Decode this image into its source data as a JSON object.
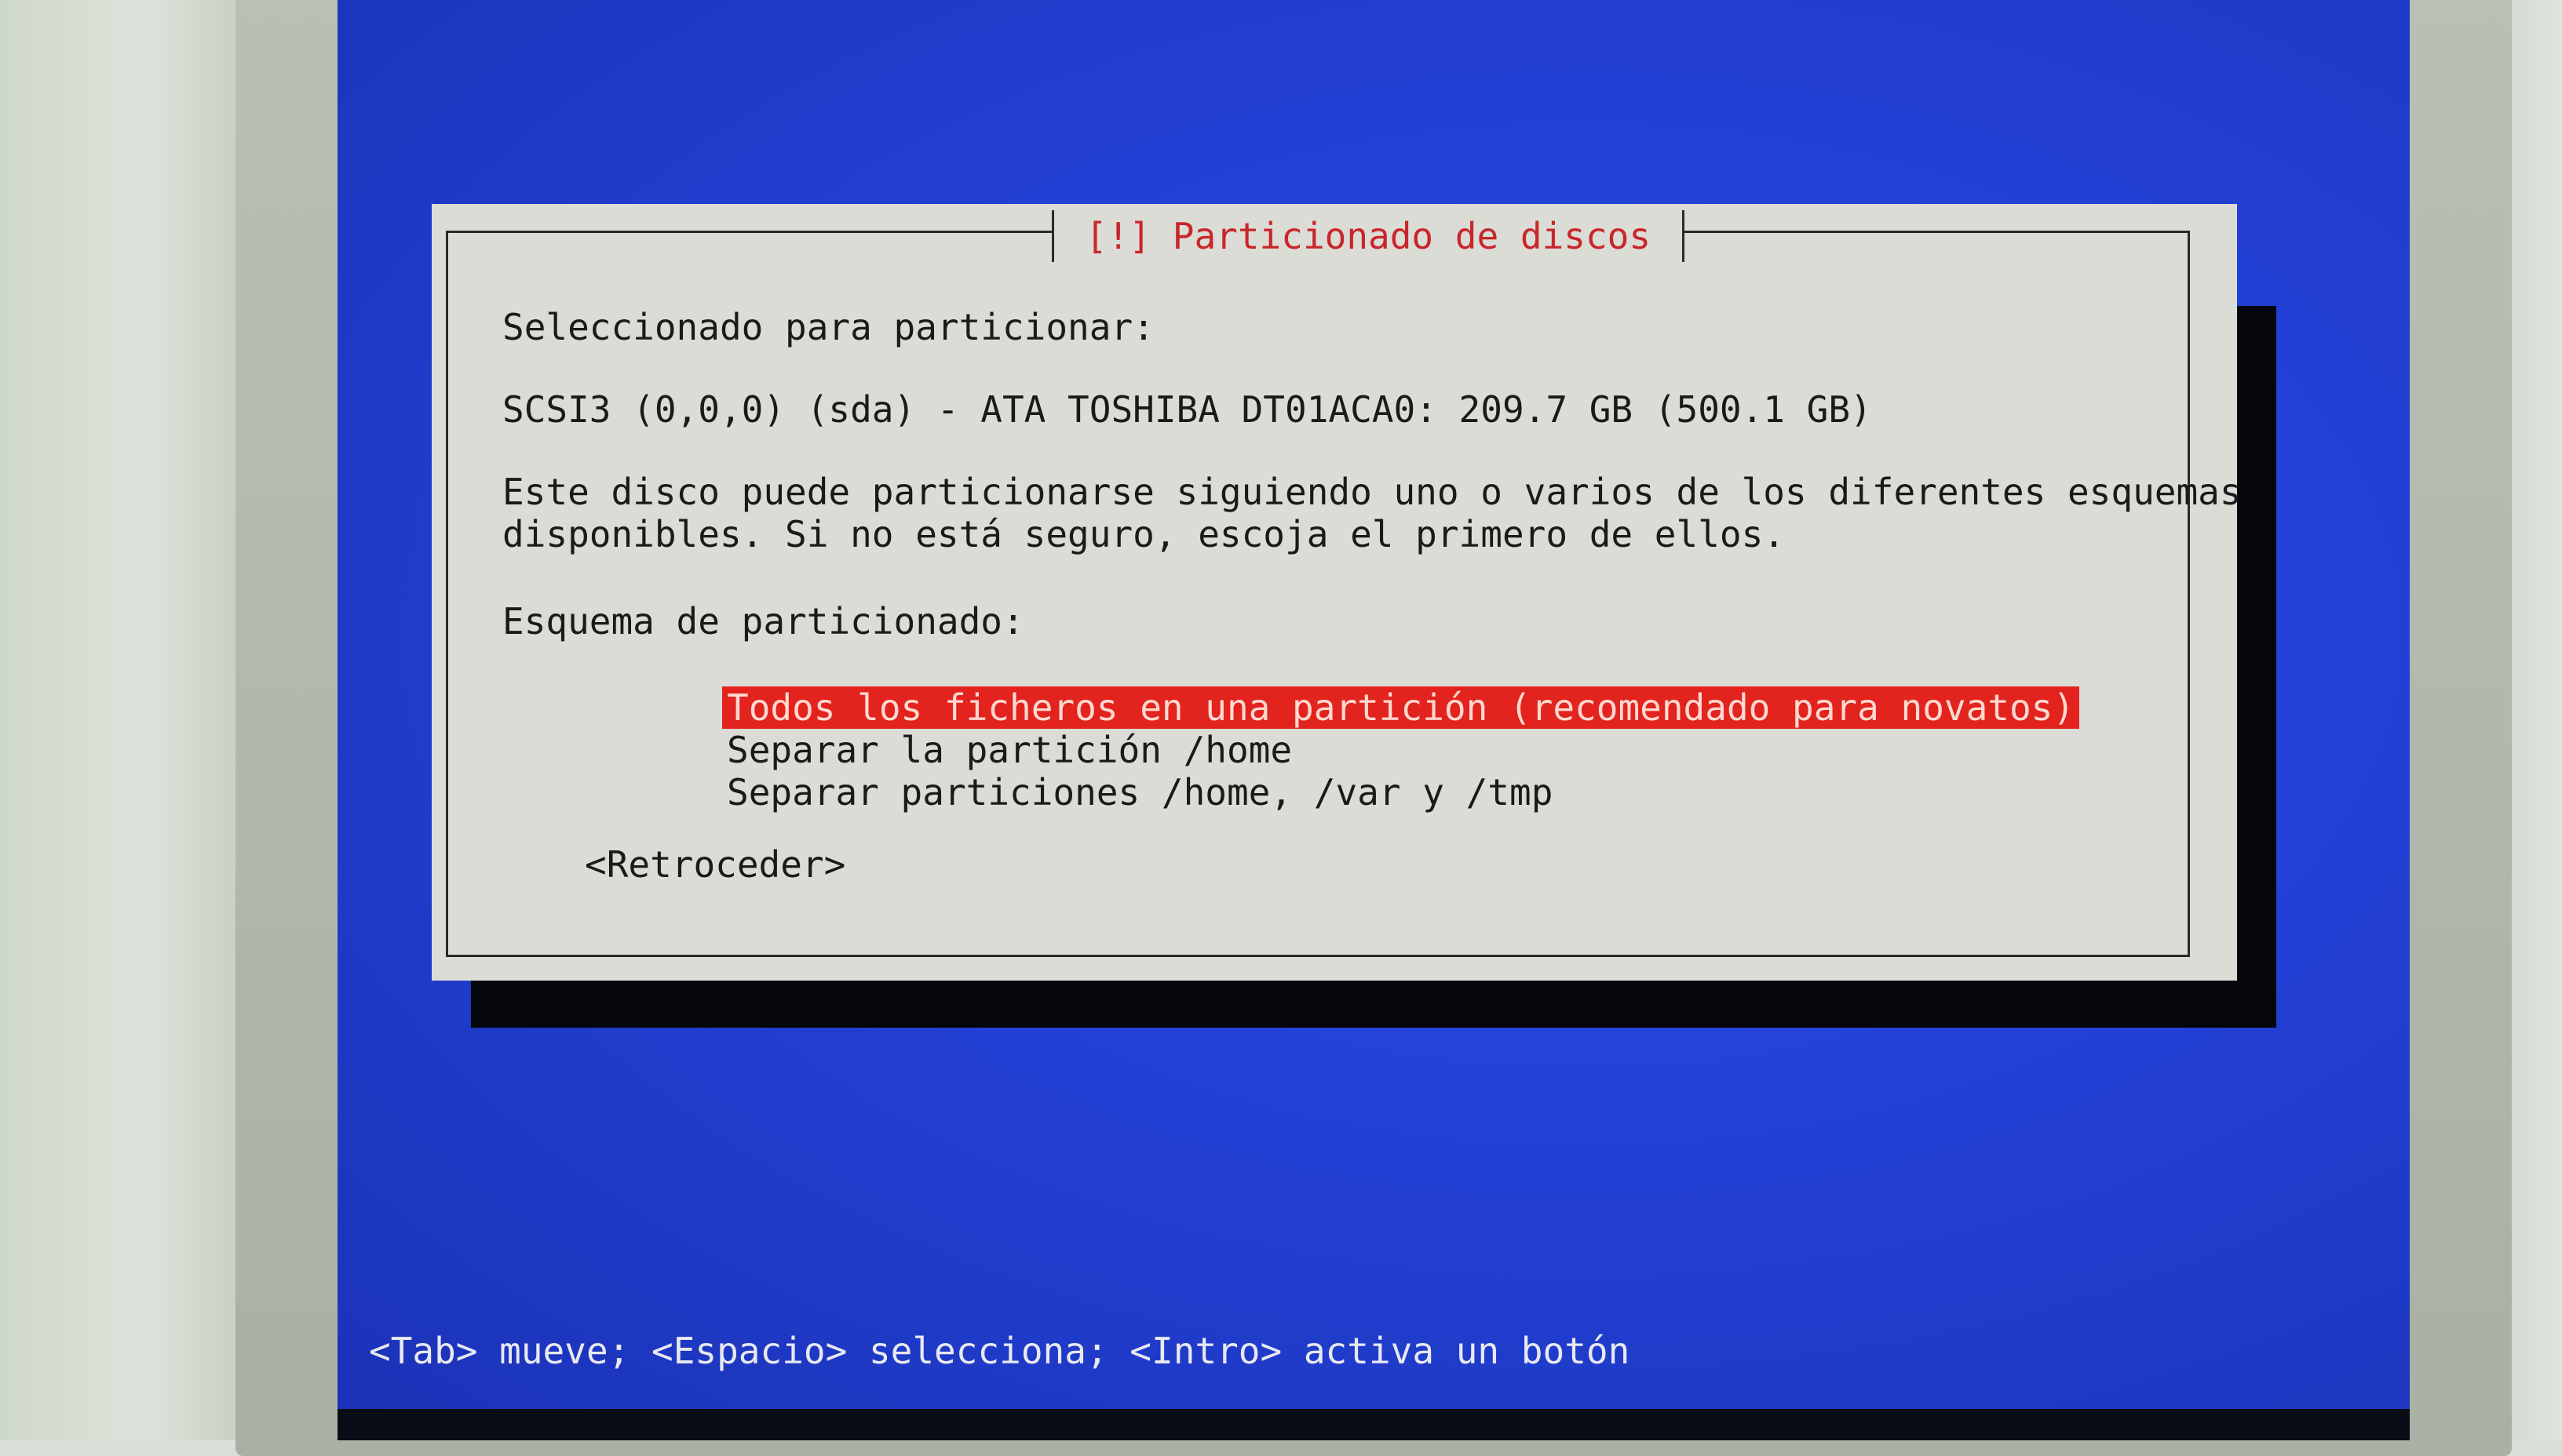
{
  "dialog": {
    "title": "[!] Particionado de discos",
    "selected_label": "Seleccionado para particionar:",
    "disk": "SCSI3 (0,0,0) (sda) - ATA TOSHIBA DT01ACA0: 209.7 GB (500.1 GB)",
    "description_line1": "Este disco puede particionarse siguiendo uno o varios de los diferentes esquemas",
    "description_line2": "disponibles. Si no está seguro, escoja el primero de ellos.",
    "scheme_label": "Esquema de particionado:",
    "options": [
      {
        "label": "Todos los ficheros en una partición (recomendado para novatos)",
        "selected": true
      },
      {
        "label": "Separar la partición /home",
        "selected": false
      },
      {
        "label": "Separar particiones /home, /var y /tmp",
        "selected": false
      }
    ],
    "back_button": "<Retroceder>"
  },
  "help_line": "<Tab> mueve; <Espacio> selecciona; <Intro> activa un botón",
  "colors": {
    "screen_background": "#2341d6",
    "dialog_background": "#dcdcd6",
    "title_text": "#c8262a",
    "selection_highlight": "#e2231e"
  }
}
